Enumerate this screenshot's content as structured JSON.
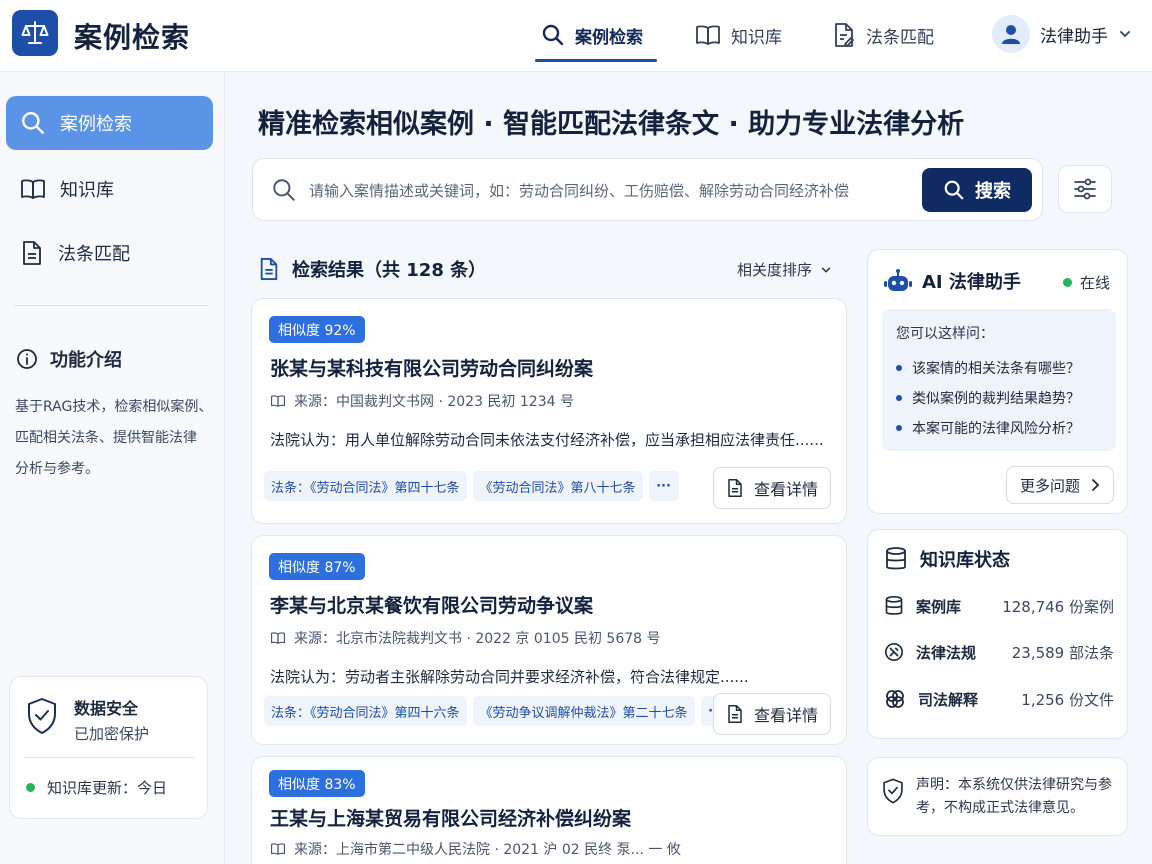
{
  "app": {
    "title": "案例检索"
  },
  "nav": {
    "items": [
      {
        "label": "案例检索",
        "icon": "search-icon",
        "active": true
      },
      {
        "label": "知识库",
        "icon": "book-icon",
        "active": false
      },
      {
        "label": "法条匹配",
        "icon": "document-edit-icon",
        "active": false
      }
    ],
    "user_name": "法律助手"
  },
  "sidebar": {
    "items": [
      {
        "label": "案例检索",
        "icon": "search-icon",
        "active": true
      },
      {
        "label": "知识库",
        "icon": "book-icon",
        "active": false
      },
      {
        "label": "法条匹配",
        "icon": "document-icon",
        "active": false
      }
    ],
    "feature": {
      "title": "功能介绍",
      "lines": [
        "基于RAG技术，检索相似案例、",
        "匹配相关法条、提供智能法律",
        "分析与参考。"
      ]
    },
    "security": {
      "title": "数据安全",
      "subtitle": "已加密保护",
      "update": "知识库更新：今日"
    }
  },
  "main": {
    "slogan": "精准检索相似案例 · 智能匹配法律条文 · 助力专业法律分析",
    "search": {
      "placeholder": "请输入案情描述或关键词，如：劳动合同纠纷、工伤赔偿、解除劳动合同经济补偿",
      "button_label": "搜索"
    },
    "results_title": "检索结果（共 128 条）",
    "sort_label": "相关度排序",
    "detail_label": "查看详情",
    "results": [
      {
        "similarity": "相似度 92%",
        "title": "张某与某科技有限公司劳动合同纠纷案",
        "source": "来源：中国裁判文书网 · 2023 民初 1234 号",
        "summary": "法院认为：用人单位解除劳动合同未依法支付经济补偿，应当承担相应法律责任......",
        "tags": [
          "法条：《劳动合同法》第四十七条",
          "《劳动合同法》第八十七条"
        ]
      },
      {
        "similarity": "相似度 87%",
        "title": "李某与北京某餐饮有限公司劳动争议案",
        "source": "来源：北京市法院裁判文书 · 2022 京 0105 民初 5678 号",
        "summary": "法院认为：劳动者主张解除劳动合同并要求经济补偿，符合法律规定......",
        "tags": [
          "法条：《劳动合同法》第四十六条",
          "《劳动争议调解仲裁法》第二十七条"
        ]
      },
      {
        "similarity": "相似度 83%",
        "title": "王某与上海某贸易有限公司经济补偿纠纷案",
        "source": "来源：上海市第二中级人民法院 · 2021 沪 02 民终 泵... 一 攸"
      }
    ]
  },
  "assistant": {
    "title": "AI 法律助手",
    "status": "在线",
    "intro": "您可以这样问：",
    "questions": [
      "该案情的相关法条有哪些？",
      "类似案例的裁判结果趋势？",
      "本案可能的法律风险分析？"
    ],
    "more_label": "更多问题"
  },
  "knowledge_base": {
    "title": "知识库状态",
    "rows": [
      {
        "label": "案例库",
        "value": "128,746 份案例",
        "icon": "database-icon"
      },
      {
        "label": "法律法规",
        "value": "23,589 部法条",
        "icon": "law-icon"
      },
      {
        "label": "司法解释",
        "value": "1,256 份文件",
        "icon": "interpretation-icon"
      }
    ]
  },
  "disclaimer": "声明：本系统仅供法律研究与参考，不构成正式法律意见。",
  "colors": {
    "primary": "#1d4fa8",
    "primary_dark": "#102a64",
    "sidebar_active": "#5b94e6",
    "badge": "#2e6fe0",
    "online": "#22b55a"
  }
}
